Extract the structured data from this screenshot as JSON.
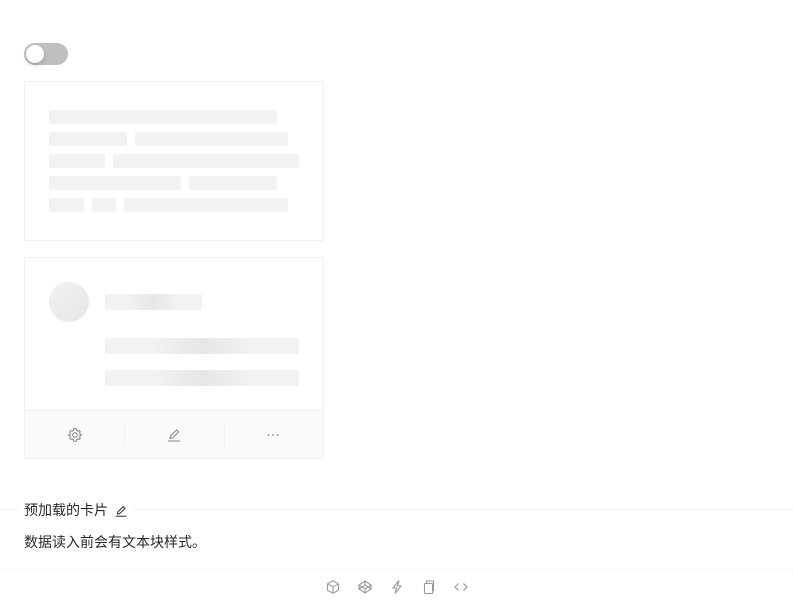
{
  "switch": {
    "checked": false
  },
  "demo": {
    "title": "预加载的卡片",
    "description": "数据读入前会有文本块样式。"
  },
  "card_actions": [
    "setting-icon",
    "edit-icon",
    "ellipsis-icon"
  ],
  "code_actions": [
    "codesandbox-icon",
    "codepen-icon",
    "thunderbolt-icon",
    "copy-icon",
    "code-icon"
  ],
  "colors": {
    "skeleton": "#f2f2f2",
    "border": "#f0f0f0",
    "icon": "#8c8c8c",
    "switch_off": "#bfbfbf"
  }
}
